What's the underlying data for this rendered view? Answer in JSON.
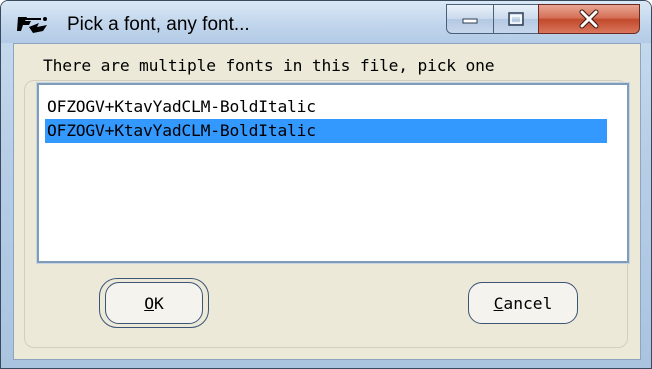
{
  "window": {
    "title": "Pick a font, any font..."
  },
  "dialog": {
    "prompt": "There are multiple fonts in this file, pick one",
    "fonts": [
      {
        "label": "OFZOGV+KtavYadCLM-BoldItalic",
        "selected": false
      },
      {
        "label": "OFZOGV+KtavYadCLM-BoldItalic",
        "selected": true
      }
    ]
  },
  "buttons": {
    "ok": {
      "mnemonic": "O",
      "rest": "K"
    },
    "cancel": {
      "mnemonic": "C",
      "rest": "ancel"
    }
  },
  "colors": {
    "selection": "#3399ff",
    "client_bg": "#ece9d8",
    "close_button": "#c24a2c"
  },
  "icons": {
    "app": "font-app-icon",
    "minimize": "minimize-icon",
    "maximize": "maximize-icon",
    "close": "close-icon"
  }
}
